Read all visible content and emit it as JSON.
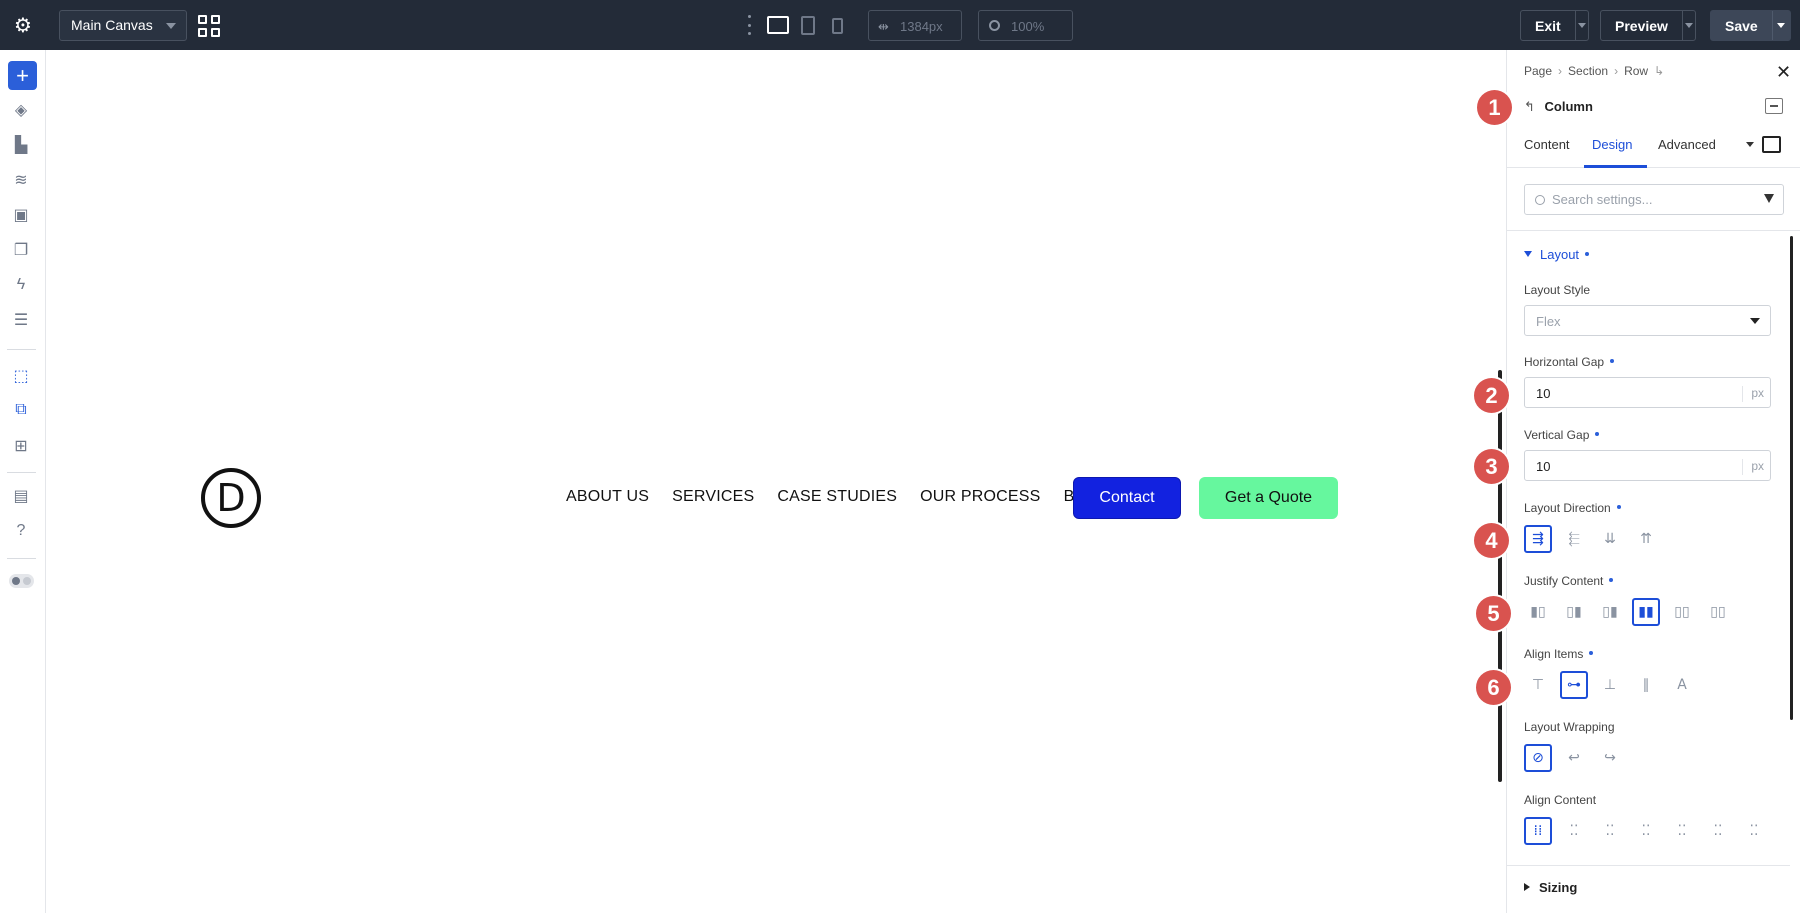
{
  "topbar": {
    "canvas_select": "Main Canvas",
    "width_value": "1384px",
    "zoom_value": "100%",
    "exit_label": "Exit",
    "preview_label": "Preview",
    "save_label": "Save"
  },
  "canvas": {
    "logo_letter": "D",
    "nav_items": [
      "ABOUT US",
      "SERVICES",
      "CASE STUDIES",
      "OUR PROCESS",
      "BLOG"
    ],
    "contact_label": "Contact",
    "quote_label": "Get a Quote",
    "contact_color": "#1222e0",
    "quote_color": "#66f79e"
  },
  "panel": {
    "breadcrumb": [
      "Page",
      "Section",
      "Row"
    ],
    "title": "Column",
    "tabs": [
      "Content",
      "Design",
      "Advanced"
    ],
    "active_tab": "Design",
    "search_placeholder": "Search settings...",
    "layout_section": "Layout",
    "layout_style_label": "Layout Style",
    "layout_style_value": "Flex",
    "horizontal_gap_label": "Horizontal Gap",
    "horizontal_gap_value": "10",
    "vertical_gap_label": "Vertical Gap",
    "vertical_gap_value": "10",
    "unit": "px",
    "layout_direction_label": "Layout Direction",
    "justify_content_label": "Justify Content",
    "align_items_label": "Align Items",
    "layout_wrapping_label": "Layout Wrapping",
    "align_content_label": "Align Content",
    "sizing_section": "Sizing"
  },
  "markers": [
    "1",
    "2",
    "3",
    "4",
    "5",
    "6"
  ],
  "colors": {
    "accent": "#1d4ed8",
    "topbar": "#232b38",
    "marker": "#d9534f"
  }
}
